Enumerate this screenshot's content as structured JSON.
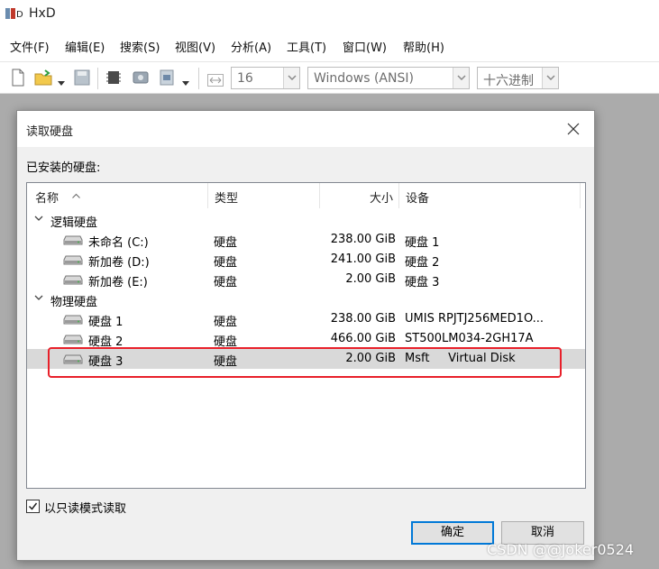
{
  "app": {
    "title": "HxD"
  },
  "menu": [
    "文件(F)",
    "编辑(E)",
    "搜索(S)",
    "视图(V)",
    "分析(A)",
    "工具(T)",
    "窗口(W)",
    "帮助(H)"
  ],
  "toolbar": {
    "bytes_per_row": "16",
    "charset": "Windows (ANSI)",
    "offset_base": "十六进制"
  },
  "dialog": {
    "title": "读取硬盘",
    "installed_label": "已安装的硬盘:",
    "columns": {
      "name": "名称",
      "type": "类型",
      "size": "大小",
      "device": "设备"
    },
    "groups": [
      {
        "label": "逻辑硬盘",
        "items": [
          {
            "name": "未命名 (C:)",
            "type": "硬盘",
            "size": "238.00 GiB",
            "device": "硬盘 1"
          },
          {
            "name": "新加卷 (D:)",
            "type": "硬盘",
            "size": "241.00 GiB",
            "device": "硬盘 2"
          },
          {
            "name": "新加卷 (E:)",
            "type": "硬盘",
            "size": "2.00 GiB",
            "device": "硬盘 3"
          }
        ]
      },
      {
        "label": "物理硬盘",
        "items": [
          {
            "name": "硬盘 1",
            "type": "硬盘",
            "size": "238.00 GiB",
            "device": "UMIS RPJTJ256MED1O..."
          },
          {
            "name": "硬盘 2",
            "type": "硬盘",
            "size": "466.00 GiB",
            "device": "ST500LM034-2GH17A"
          },
          {
            "name": "硬盘 3",
            "type": "硬盘",
            "size": "2.00 GiB",
            "device": "Msft     Virtual Disk"
          }
        ]
      }
    ],
    "readonly_label": "以只读模式读取",
    "readonly_checked": true,
    "ok_label": "确定",
    "cancel_label": "取消"
  },
  "watermark": "CSDN @@Joker0524",
  "colors": {
    "highlight": "#e8202a",
    "focus": "#0078d7",
    "workspace": "#ababab"
  }
}
